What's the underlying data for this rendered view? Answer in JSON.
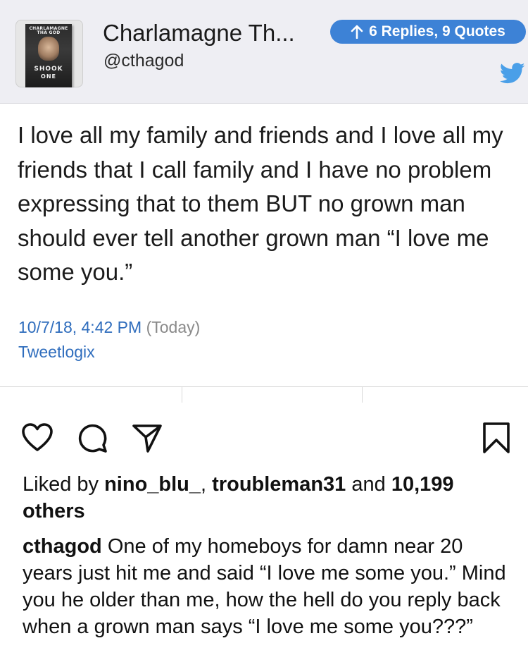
{
  "tweet": {
    "avatar_icon": "book-cover-avatar",
    "book": {
      "author": "CHARLAMAGNE THA GOD",
      "title_line1": "SHOOK",
      "title_line2": "ONE"
    },
    "display_name": "Charlamagne Th...",
    "handle": "@cthagod",
    "replies_badge": "6 Replies, 9 Quotes",
    "text": "I love all my family and friends and I love all my friends that I call family and I have no problem expressing that to them BUT no grown man should ever tell another grown man “I love me some you.”",
    "date": "10/7/18, 4:42 PM",
    "date_note": "(Today)",
    "source": "Tweetlogix",
    "colors": {
      "link": "#2f6dbd",
      "badge": "#3d82d6",
      "twitter_bird": "#4a9fe8"
    }
  },
  "post": {
    "actions": [
      "heart-icon",
      "comment-icon",
      "share-icon",
      "bookmark-icon"
    ],
    "likes_prefix": "Liked by ",
    "liker1": "nino_blu_",
    "sep": ", ",
    "liker2": "troubleman31",
    "and_text": " and",
    "others": "10,199 others",
    "caption_user": "cthagod",
    "caption_text": " One of my homeboys for damn near 20 years just hit me and said “I love me some you.” Mind you he older than me, how the hell do you reply back when a grown man says “I love me some you???”"
  }
}
